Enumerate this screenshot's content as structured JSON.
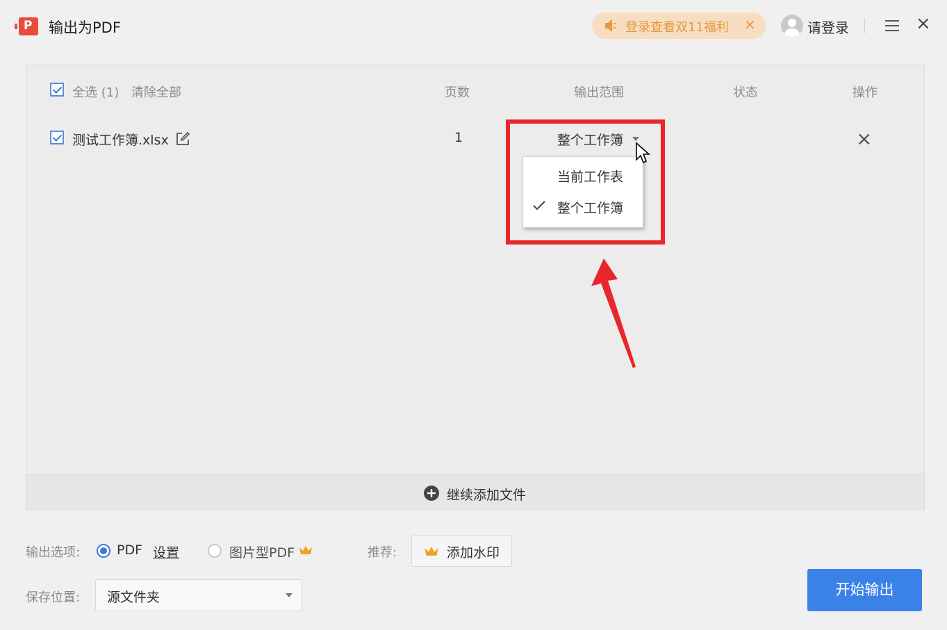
{
  "window": {
    "title": "输出为PDF",
    "promo_text": "登录查看双11福利",
    "promo_close": "×",
    "login": "请登录",
    "close": "×"
  },
  "table": {
    "select_all": "全选 (1)",
    "clear_all": "清除全部",
    "columns": {
      "pages": "页数",
      "range": "输出范围",
      "status": "状态",
      "action": "操作"
    },
    "rows": [
      {
        "filename": "测试工作簿.xlsx",
        "pages": "1",
        "range": "整个工作簿",
        "remove": "×"
      }
    ],
    "range_options": [
      {
        "label": "当前工作表",
        "selected": false
      },
      {
        "label": "整个工作簿",
        "selected": true
      }
    ],
    "add_more": "继续添加文件"
  },
  "options": {
    "output_label": "输出选项:",
    "pdf_label": "PDF",
    "settings": "设置",
    "image_pdf_label": "图片型PDF",
    "recommend_label": "推荐:",
    "watermark_button": "添加水印",
    "save_label": "保存位置:",
    "save_value": "源文件夹",
    "start_button": "开始输出"
  },
  "colors": {
    "accent": "#3a82e8",
    "highlight": "#e8262c",
    "promo": "#e59a3c",
    "crown": "#f0a11f"
  }
}
